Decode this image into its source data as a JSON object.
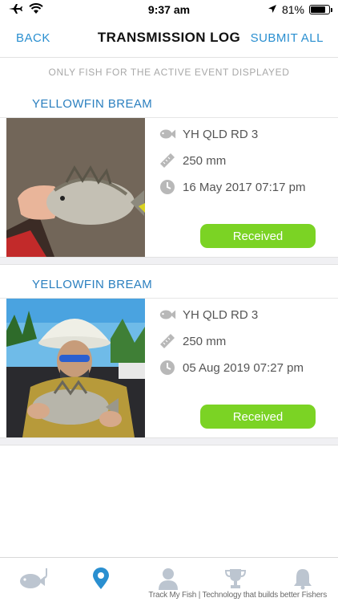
{
  "status_bar": {
    "time": "9:37 am",
    "battery_text": "81%",
    "battery_level": 0.81
  },
  "nav": {
    "back_label": "BACK",
    "title": "TRANSMISSION LOG",
    "submit_label": "SUBMIT ALL"
  },
  "info_note": "ONLY FISH FOR THE ACTIVE EVENT DISPLAYED",
  "entries": [
    {
      "species": "YELLOWFIN BREAM",
      "event": "YH QLD RD 3",
      "length": "250 mm",
      "datetime": "16 May 2017 07:17 pm",
      "status": "Received"
    },
    {
      "species": "YELLOWFIN BREAM",
      "event": "YH QLD RD 3",
      "length": "250 mm",
      "datetime": "05 Aug 2019 07:27 pm",
      "status": "Received"
    }
  ],
  "icons": {
    "event": "fish-icon",
    "length": "ruler-icon",
    "datetime": "clock-icon"
  },
  "tabs": [
    {
      "icon": "fish-hook-icon",
      "active": false
    },
    {
      "icon": "location-pin-icon",
      "active": true
    },
    {
      "icon": "profile-icon",
      "active": false
    },
    {
      "icon": "trophy-icon",
      "active": false
    },
    {
      "icon": "bell-icon",
      "active": false
    }
  ],
  "footer_text": "Track My Fish | Technology that builds better Fishers",
  "colors": {
    "accent": "#2a8fd0",
    "species_title": "#2a7fbf",
    "status_received": "#7bd324",
    "icon_gray": "#b8b8b8"
  }
}
